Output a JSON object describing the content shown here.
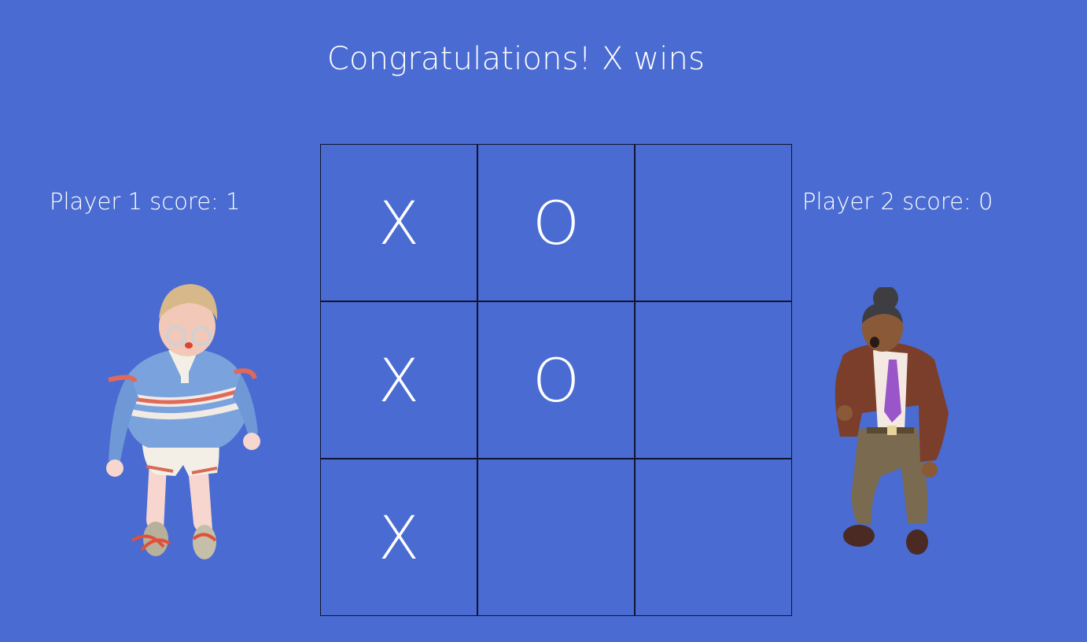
{
  "status": {
    "message": "Congratulations! X wins"
  },
  "players": [
    {
      "label": "Player 1 score: 1",
      "score": 1,
      "mark": "X"
    },
    {
      "label": "Player 2 score: 0",
      "score": 0,
      "mark": "O"
    }
  ],
  "board": {
    "cells": [
      "X",
      "O",
      "",
      "X",
      "O",
      "",
      "X",
      "",
      ""
    ]
  },
  "colors": {
    "background": "#4a6bd1",
    "grid_line": "#0f1530",
    "text": "#ffffff"
  },
  "avatars": [
    {
      "icon": "boy-with-glasses-striped-sweater-icon"
    },
    {
      "icon": "woman-in-brown-jacket-purple-tie-icon"
    }
  ]
}
